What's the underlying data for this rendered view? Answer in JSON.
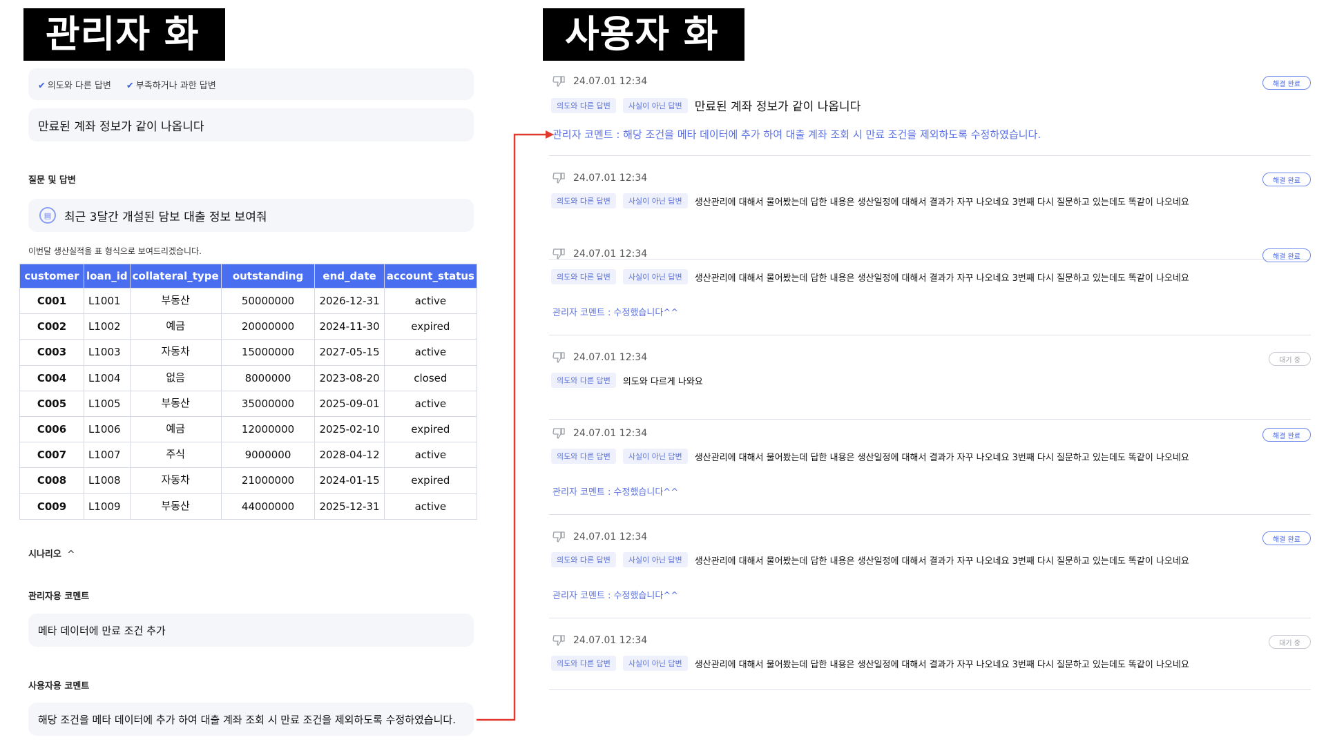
{
  "labels": {
    "admin": "관리자 화면",
    "user": "사용자 화면"
  },
  "admin": {
    "reasons": [
      "의도와 다른 답변",
      "부족하거나 과한 답변"
    ],
    "issue": "만료된 계좌 정보가 같이 나옵니다",
    "qa_title": "질문 및 답변",
    "question": "최근 3달간 개설된 담보 대출 정보 보여줘",
    "answer_intro": "이번달 생산실적을 표 형식으로 보여드리겠습니다.",
    "table": {
      "columns": [
        "customer",
        "loan_id",
        "collateral_type",
        "outstanding",
        "end_date",
        "account_status"
      ],
      "rows": [
        [
          "C001",
          "L1001",
          "부동산",
          "50000000",
          "2026-12-31",
          "active"
        ],
        [
          "C002",
          "L1002",
          "예금",
          "20000000",
          "2024-11-30",
          "expired"
        ],
        [
          "C003",
          "L1003",
          "자동차",
          "15000000",
          "2027-05-15",
          "active"
        ],
        [
          "C004",
          "L1004",
          "없음",
          "8000000",
          "2023-08-20",
          "closed"
        ],
        [
          "C005",
          "L1005",
          "부동산",
          "35000000",
          "2025-09-01",
          "active"
        ],
        [
          "C006",
          "L1006",
          "예금",
          "12000000",
          "2025-02-10",
          "expired"
        ],
        [
          "C007",
          "L1007",
          "주식",
          "9000000",
          "2028-04-12",
          "active"
        ],
        [
          "C008",
          "L1008",
          "자동차",
          "21000000",
          "2024-01-15",
          "expired"
        ],
        [
          "C009",
          "L1009",
          "부동산",
          "44000000",
          "2025-12-31",
          "active"
        ]
      ]
    },
    "scenario_label": "시나리오",
    "scenario_chevron": "^",
    "admin_comment_title": "관리자용 코멘트",
    "admin_comment": "메타 데이터에 만료 조건 추가",
    "user_comment_title": "사용자용 코멘트",
    "user_comment": "해당 조건을 메타 데이터에 추가 하여 대출 계좌 조회 시 만료 조건을 제외하도록 수정하였습니다."
  },
  "feed": [
    {
      "time": "24.07.01 12:34",
      "status": "해결 완료",
      "status_type": "done",
      "tags": [
        "의도와 다른 답변",
        "사실이 아닌 답변"
      ],
      "text": "만료된 계좌 정보가 같이 나옵니다",
      "reply": "관리자 코멘트 : 해당 조건을 메타 데이터에 추가 하여 대출 계좌 조회 시 만료 조건을 제외하도록 수정하였습니다."
    },
    {
      "time": "24.07.01 12:34",
      "status": "해결 완료",
      "status_type": "done",
      "tags": [
        "의도와 다른 답변",
        "사실이 아닌 답변"
      ],
      "text": "생산관리에 대해서 물어봤는데 답한 내용은 생산일정에 대해서 결과가 자꾸 나오네요 3번째 다시 질문하고 있는데도 똑같이 나오네요",
      "reply": ""
    },
    {
      "time": "24.07.01 12:34",
      "status": "해결 완료",
      "status_type": "done",
      "tags": [
        "의도와 다른 답변",
        "사실이 아닌 답변"
      ],
      "text": "생산관리에 대해서 물어봤는데 답한 내용은 생산일정에 대해서 결과가 자꾸 나오네요 3번째 다시 질문하고 있는데도 똑같이 나오네요",
      "reply": "관리자 코멘트 : 수정했습니다^^"
    },
    {
      "time": "24.07.01 12:34",
      "status": "대기 중",
      "status_type": "wait",
      "tags": [
        "의도와 다른 답변"
      ],
      "text": "의도와 다르게 나와요",
      "reply": ""
    },
    {
      "time": "24.07.01 12:34",
      "status": "해결 완료",
      "status_type": "done",
      "tags": [
        "의도와 다른 답변",
        "사실이 아닌 답변"
      ],
      "text": "생산관리에 대해서 물어봤는데 답한 내용은 생산일정에 대해서 결과가 자꾸 나오네요 3번째 다시 질문하고 있는데도 똑같이 나오네요",
      "reply": "관리자 코멘트 : 수정했습니다^^"
    },
    {
      "time": "24.07.01 12:34",
      "status": "해결 완료",
      "status_type": "done",
      "tags": [
        "의도와 다른 답변",
        "사실이 아닌 답변"
      ],
      "text": "생산관리에 대해서 물어봤는데 답한 내용은 생산일정에 대해서 결과가 자꾸 나오네요 3번째 다시 질문하고 있는데도 똑같이 나오네요",
      "reply": "관리자 코멘트 : 수정했습니다^^"
    },
    {
      "time": "24.07.01 12:34",
      "status": "대기 중",
      "status_type": "wait",
      "tags": [
        "의도와 다른 답변",
        "사실이 아닌 답변"
      ],
      "text": "생산관리에 대해서 물어봤는데 답한 내용은 생산일정에 대해서 결과가 자꾸 나오네요 3번째 다시 질문하고 있는데도 똑같이 나오네요",
      "reply": ""
    }
  ],
  "colors": {
    "accent": "#4a6ef0",
    "arrow": "#e03a2f",
    "reply": "#5b70e3"
  },
  "icons": {
    "reason_check": "check-icon",
    "question": "chat-bubble-icon",
    "feed_meta": "thumbs-down-icon"
  }
}
